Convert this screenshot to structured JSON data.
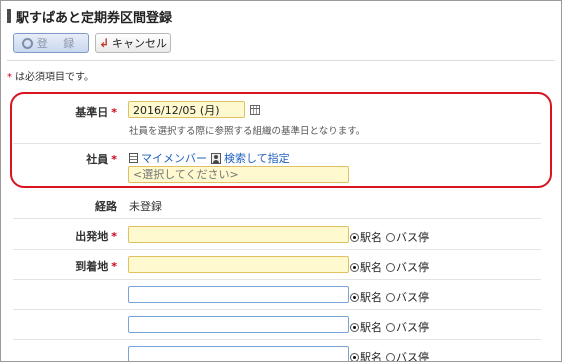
{
  "page": {
    "title": "駅すぱあと定期券区間登録"
  },
  "toolbar": {
    "register_label": "登 録",
    "cancel_label": "キャンセル"
  },
  "required_note": {
    "star": "*",
    "text": "は必須項目です。"
  },
  "form": {
    "base_date": {
      "label": "基準日",
      "star": "*",
      "value": "2016/12/05 (月)",
      "hint": "社員を選択する際に参照する組織の基準日となります。"
    },
    "employee": {
      "label": "社員",
      "star": "*",
      "my_member_link": "マイメンバー",
      "search_link": "検索して指定",
      "placeholder": "<選択してください>"
    },
    "route": {
      "label": "経路",
      "value": "未登録"
    },
    "departure": {
      "label": "出発地",
      "star": "*",
      "value": ""
    },
    "arrival": {
      "label": "到着地",
      "star": "*",
      "value": ""
    },
    "radio_options": {
      "station": "駅名",
      "bus": "バス停"
    }
  }
}
